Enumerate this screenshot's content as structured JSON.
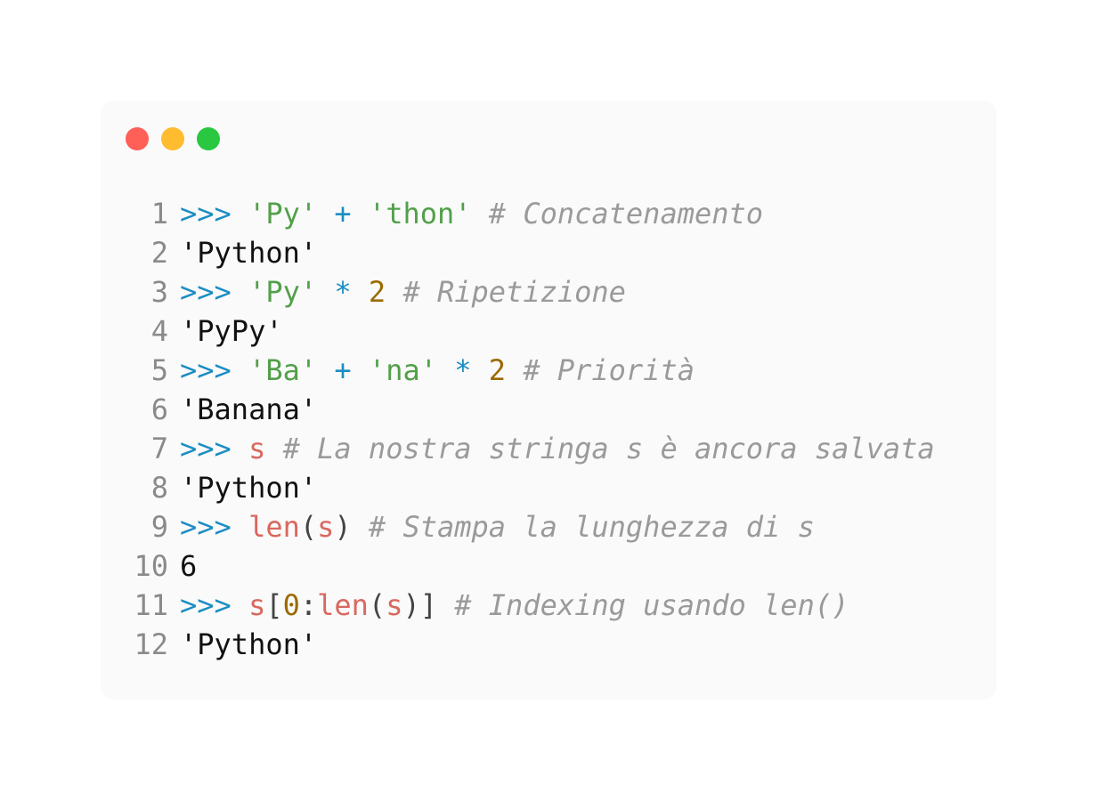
{
  "window": {
    "dots": [
      "close",
      "minimize",
      "maximize"
    ],
    "colors": {
      "close": "#fe5f57",
      "minimize": "#febc2e",
      "maximize": "#29c840"
    }
  },
  "code": {
    "lines": [
      {
        "number": "1",
        "tokens": [
          {
            "t": "prompt",
            "v": ">>>"
          },
          {
            "t": "plain",
            "v": " "
          },
          {
            "t": "string",
            "v": "'Py'"
          },
          {
            "t": "plain",
            "v": " "
          },
          {
            "t": "op",
            "v": "+"
          },
          {
            "t": "plain",
            "v": " "
          },
          {
            "t": "string",
            "v": "'thon'"
          },
          {
            "t": "plain",
            "v": " "
          },
          {
            "t": "comment",
            "v": "# Concatenamento"
          }
        ]
      },
      {
        "number": "2",
        "tokens": [
          {
            "t": "output",
            "v": "'Python'"
          }
        ]
      },
      {
        "number": "3",
        "tokens": [
          {
            "t": "prompt",
            "v": ">>>"
          },
          {
            "t": "plain",
            "v": " "
          },
          {
            "t": "string",
            "v": "'Py'"
          },
          {
            "t": "plain",
            "v": " "
          },
          {
            "t": "op",
            "v": "*"
          },
          {
            "t": "plain",
            "v": " "
          },
          {
            "t": "number",
            "v": "2"
          },
          {
            "t": "plain",
            "v": " "
          },
          {
            "t": "comment",
            "v": "# Ripetizione"
          }
        ]
      },
      {
        "number": "4",
        "tokens": [
          {
            "t": "output",
            "v": "'PyPy'"
          }
        ]
      },
      {
        "number": "5",
        "tokens": [
          {
            "t": "prompt",
            "v": ">>>"
          },
          {
            "t": "plain",
            "v": " "
          },
          {
            "t": "string",
            "v": "'Ba'"
          },
          {
            "t": "plain",
            "v": " "
          },
          {
            "t": "op",
            "v": "+"
          },
          {
            "t": "plain",
            "v": " "
          },
          {
            "t": "string",
            "v": "'na'"
          },
          {
            "t": "plain",
            "v": " "
          },
          {
            "t": "op",
            "v": "*"
          },
          {
            "t": "plain",
            "v": " "
          },
          {
            "t": "number",
            "v": "2"
          },
          {
            "t": "plain",
            "v": " "
          },
          {
            "t": "comment",
            "v": "# Priorità"
          }
        ]
      },
      {
        "number": "6",
        "tokens": [
          {
            "t": "output",
            "v": "'Banana'"
          }
        ]
      },
      {
        "number": "7",
        "tokens": [
          {
            "t": "prompt",
            "v": ">>>"
          },
          {
            "t": "plain",
            "v": " "
          },
          {
            "t": "name",
            "v": "s"
          },
          {
            "t": "plain",
            "v": " "
          },
          {
            "t": "comment",
            "v": "# La nostra stringa s è ancora salvata"
          }
        ]
      },
      {
        "number": "8",
        "tokens": [
          {
            "t": "output",
            "v": "'Python'"
          }
        ]
      },
      {
        "number": "9",
        "tokens": [
          {
            "t": "prompt",
            "v": ">>>"
          },
          {
            "t": "plain",
            "v": " "
          },
          {
            "t": "name",
            "v": "len"
          },
          {
            "t": "punct",
            "v": "("
          },
          {
            "t": "name",
            "v": "s"
          },
          {
            "t": "punct",
            "v": ")"
          },
          {
            "t": "plain",
            "v": " "
          },
          {
            "t": "comment",
            "v": "# Stampa la lunghezza di s"
          }
        ]
      },
      {
        "number": "10",
        "tokens": [
          {
            "t": "output",
            "v": "6"
          }
        ]
      },
      {
        "number": "11",
        "tokens": [
          {
            "t": "prompt",
            "v": ">>>"
          },
          {
            "t": "plain",
            "v": " "
          },
          {
            "t": "name",
            "v": "s"
          },
          {
            "t": "punct",
            "v": "["
          },
          {
            "t": "number",
            "v": "0"
          },
          {
            "t": "punct",
            "v": ":"
          },
          {
            "t": "name",
            "v": "len"
          },
          {
            "t": "punct",
            "v": "("
          },
          {
            "t": "name",
            "v": "s"
          },
          {
            "t": "punct",
            "v": ")]"
          },
          {
            "t": "plain",
            "v": " "
          },
          {
            "t": "comment",
            "v": "# Indexing usando len()"
          }
        ]
      },
      {
        "number": "12",
        "tokens": [
          {
            "t": "output",
            "v": "'Python'"
          }
        ]
      }
    ]
  }
}
